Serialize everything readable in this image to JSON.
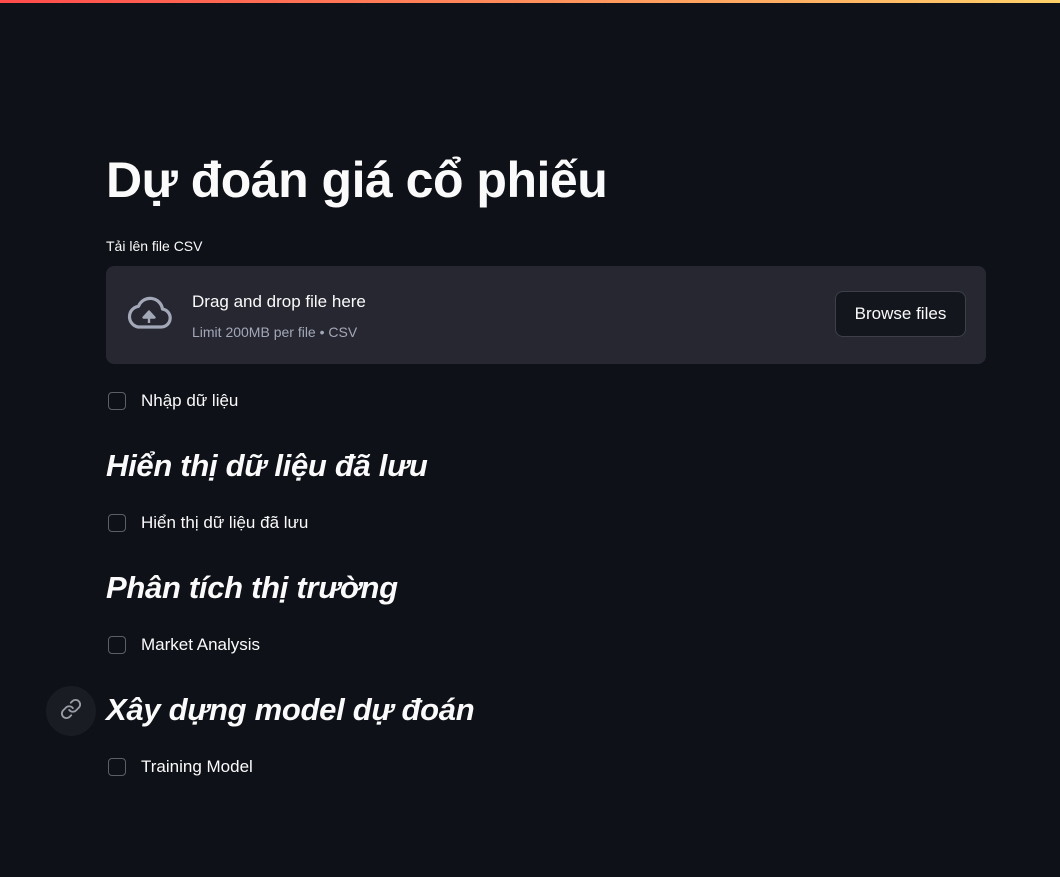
{
  "page": {
    "title": "Dự đoán giá cổ phiếu"
  },
  "uploader": {
    "label": "Tải lên file CSV",
    "drop_text": "Drag and drop file here",
    "limit_text": "Limit 200MB per file • CSV",
    "browse_label": "Browse files",
    "icon": "cloud-upload-icon"
  },
  "checkboxes": {
    "input_data": {
      "label": "Nhập dữ liệu",
      "checked": false
    },
    "show_saved": {
      "label": "Hiển thị dữ liệu đã lưu",
      "checked": false
    },
    "market_analysis": {
      "label": "Market Analysis",
      "checked": false
    },
    "training_model": {
      "label": "Training Model",
      "checked": false
    }
  },
  "sections": {
    "saved_data": {
      "heading": "Hiển thị dữ liệu đã lưu"
    },
    "market": {
      "heading": "Phân tích thị trường"
    },
    "model": {
      "heading": "Xây dựng model dự đoán",
      "anchor_icon": "link-icon"
    }
  },
  "colors": {
    "background": "#0e1117",
    "dropzone_bg": "#262730",
    "text": "#fafafa",
    "muted_text": "#a3a8b8",
    "accent_gradient_start": "#ff4b4b",
    "accent_gradient_end": "#ffd16a"
  }
}
